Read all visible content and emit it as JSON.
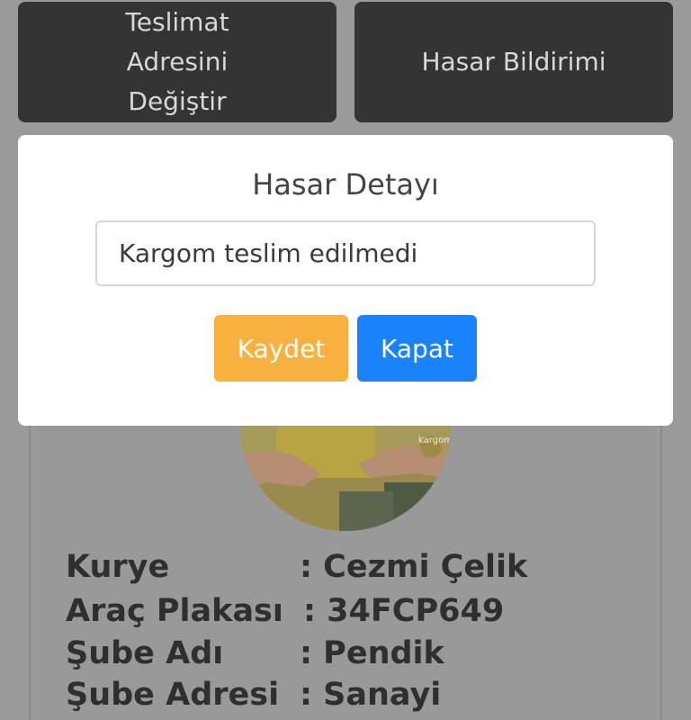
{
  "top_buttons": {
    "change_address": "Teslimat Adresini Değiştir",
    "report_damage": "Hasar Bildirimi"
  },
  "modal": {
    "title": "Hasar Detayı",
    "input_value": "Kargom teslim edilmedi",
    "save_label": "Kaydet",
    "close_label": "Kapat",
    "colors": {
      "save": "#f8b13e",
      "close": "#1a82fb"
    }
  },
  "courier": {
    "rows": [
      {
        "label": "Kurye",
        "value": ": Cezmi Çelik"
      },
      {
        "label": "Araç Plakası",
        "value": ": 34FCP649"
      },
      {
        "label": "Şube Adı",
        "value": ": Pendik"
      },
      {
        "label": "Şube Adresi",
        "value": ": Sanayi"
      }
    ]
  },
  "photo": {
    "logo_text": "kargom",
    "icon": "courier-delivery-photo"
  }
}
